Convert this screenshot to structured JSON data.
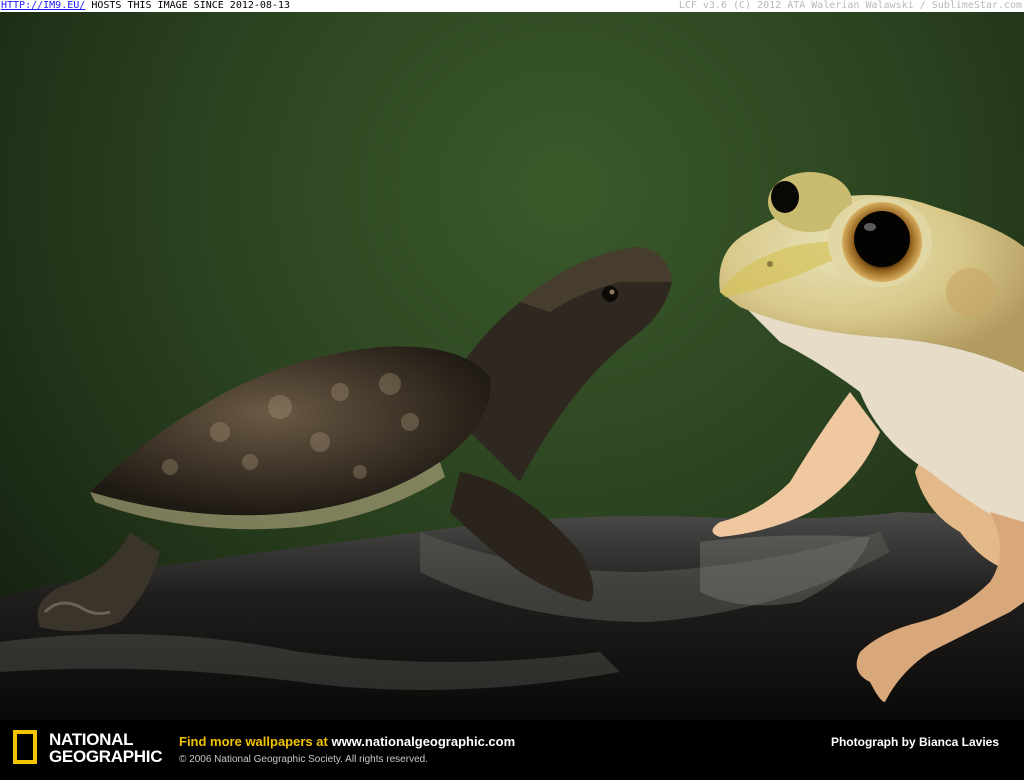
{
  "top_bar": {
    "link_text": "HTTP://IM9.EU/",
    "hosts_text": "HOSTS THIS IMAGE SINCE 2012-08-13",
    "credit_text": "LCF v3.6 (C) 2012 ATA Walerian Walawski / SublimeStar.com"
  },
  "photo": {
    "subjects": [
      "turtle",
      "frog",
      "rock"
    ]
  },
  "footer": {
    "logo_line1": "NATIONAL",
    "logo_line2": "GEOGRAPHIC",
    "find_more_text": "Find more wallpapers at",
    "website": "www.nationalgeographic.com",
    "copyright": "© 2006 National Geographic Society. All rights reserved.",
    "photo_credit": "Photograph by Bianca Lavies"
  },
  "colors": {
    "brand_yellow": "#f5c400",
    "background_green": "#2b4320"
  }
}
